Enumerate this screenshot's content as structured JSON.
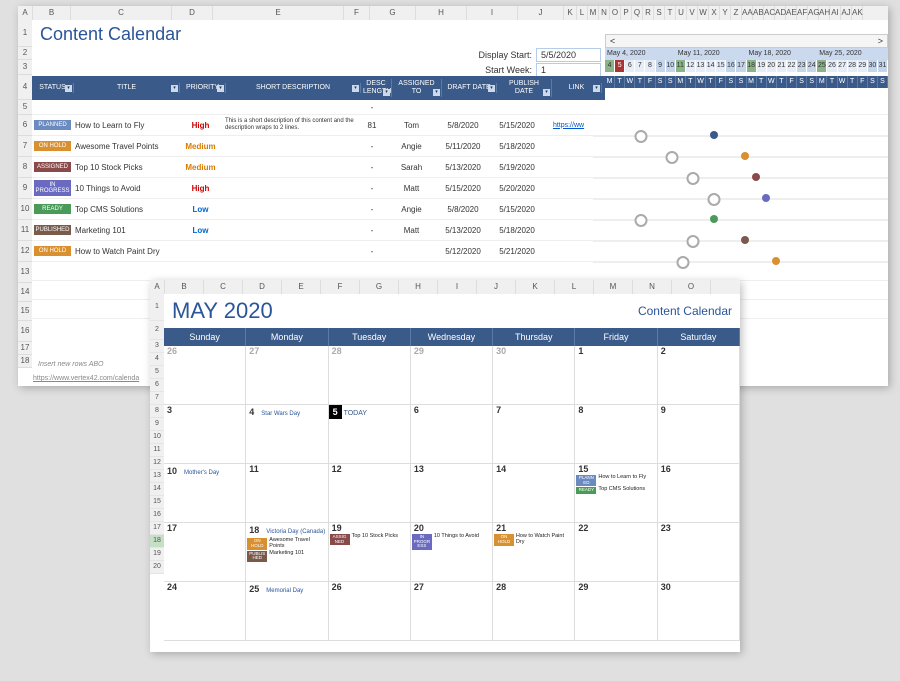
{
  "sheet1": {
    "title": "Content Calendar",
    "col_headers": [
      "A",
      "B",
      "C",
      "D",
      "E",
      "F",
      "G",
      "H",
      "I",
      "J",
      "K",
      "L",
      "M",
      "N",
      "O",
      "P",
      "Q",
      "R",
      "S",
      "T",
      "U",
      "V",
      "W",
      "X",
      "Y",
      "Z",
      "AA",
      "AB",
      "AC",
      "AD",
      "AE",
      "AF",
      "AG",
      "AH",
      "AI",
      "AJ",
      "AK"
    ],
    "row_numbers": [
      "1",
      "2",
      "3",
      "4",
      "5",
      "6",
      "7",
      "8",
      "9",
      "10",
      "11",
      "12",
      "13",
      "14",
      "15",
      "16",
      "17",
      "18"
    ],
    "display_start_label": "Display Start:",
    "display_start_value": "5/5/2020",
    "start_week_label": "Start Week:",
    "start_week_value": "1",
    "week_headers": [
      "May 4, 2020",
      "May 11, 2020",
      "May 18, 2020",
      "May 25, 2020"
    ],
    "day_letters": [
      "M",
      "T",
      "W",
      "T",
      "F",
      "S",
      "S",
      "M",
      "T",
      "W",
      "T",
      "F",
      "S",
      "S",
      "M",
      "T",
      "W",
      "T",
      "F",
      "S",
      "S",
      "M",
      "T",
      "W",
      "T",
      "F",
      "S",
      "S"
    ],
    "day_numbers": [
      "4",
      "5",
      "6",
      "7",
      "8",
      "9",
      "10",
      "11",
      "12",
      "13",
      "14",
      "15",
      "16",
      "17",
      "18",
      "19",
      "20",
      "21",
      "22",
      "23",
      "24",
      "25",
      "26",
      "27",
      "28",
      "29",
      "30",
      "31"
    ],
    "today_index": 1,
    "table_headers": [
      "STATUS",
      "TITLE",
      "PRIORITY",
      "SHORT DESCRIPTION",
      "DESC LENGTH",
      "ASSIGNED TO",
      "DRAFT DATE",
      "PUBLISH DATE",
      "LINK"
    ],
    "rows": [
      {
        "status": "PLANNED",
        "status_cls": "PLANNED",
        "title": "How to Learn to Fly",
        "priority": "High",
        "desc": "This is a short description of this content and the description wraps to 2 lines.",
        "desc_len": "81",
        "assigned": "Tom",
        "draft": "5/8/2020",
        "publish": "5/15/2020",
        "link": "https://ww",
        "draft_idx": 4,
        "pub_idx": 11,
        "pub_color": "#3a5a8a"
      },
      {
        "status": "ON HOLD",
        "status_cls": "ONHOLD",
        "title": "Awesome Travel Points",
        "priority": "Medium",
        "desc": "",
        "desc_len": "-",
        "assigned": "Angie",
        "draft": "5/11/2020",
        "publish": "5/18/2020",
        "link": "",
        "draft_idx": 7,
        "pub_idx": 14,
        "pub_color": "#d89030"
      },
      {
        "status": "ASSIGNED",
        "status_cls": "ASSIGNED",
        "title": "Top 10 Stock Picks",
        "priority": "Medium",
        "desc": "",
        "desc_len": "-",
        "assigned": "Sarah",
        "draft": "5/13/2020",
        "publish": "5/19/2020",
        "link": "",
        "draft_idx": 9,
        "pub_idx": 15,
        "pub_color": "#8a4a4a"
      },
      {
        "status": "IN PROGRESS",
        "status_cls": "INPROGRESS",
        "title": "10 Things to Avoid",
        "priority": "High",
        "desc": "",
        "desc_len": "-",
        "assigned": "Matt",
        "draft": "5/15/2020",
        "publish": "5/20/2020",
        "link": "",
        "draft_idx": 11,
        "pub_idx": 16,
        "pub_color": "#6a6ac0"
      },
      {
        "status": "READY",
        "status_cls": "READY",
        "title": "Top CMS Solutions",
        "priority": "Low",
        "desc": "",
        "desc_len": "-",
        "assigned": "Angie",
        "draft": "5/8/2020",
        "publish": "5/15/2020",
        "link": "",
        "draft_idx": 4,
        "pub_idx": 11,
        "pub_color": "#4a9a5a"
      },
      {
        "status": "PUBLISHED",
        "status_cls": "PUBLISHED",
        "title": "Marketing 101",
        "priority": "Low",
        "desc": "",
        "desc_len": "-",
        "assigned": "Matt",
        "draft": "5/13/2020",
        "publish": "5/18/2020",
        "link": "",
        "draft_idx": 9,
        "pub_idx": 14,
        "pub_color": "#7a5a4a"
      },
      {
        "status": "ON HOLD",
        "status_cls": "ONHOLD",
        "title": "How to Watch Paint Dry",
        "priority": "",
        "desc": "",
        "desc_len": "-",
        "assigned": "",
        "draft": "5/12/2020",
        "publish": "5/21/2020",
        "link": "",
        "draft_idx": 8,
        "pub_idx": 17,
        "pub_color": "#d89030"
      }
    ],
    "footer_note": "Insert new rows ABO",
    "footer_link": "https://www.vertex42.com/calenda"
  },
  "sheet2": {
    "col_headers": [
      "A",
      "B",
      "C",
      "D",
      "E",
      "F",
      "G",
      "H",
      "I",
      "J",
      "K",
      "L",
      "M",
      "N",
      "O"
    ],
    "row_numbers": [
      "1",
      "2",
      "3",
      "4",
      "5",
      "6",
      "7",
      "8",
      "9",
      "10",
      "11",
      "12",
      "13",
      "14",
      "15",
      "16",
      "17",
      "18",
      "19",
      "20"
    ],
    "month": "MAY 2020",
    "name": "Content Calendar",
    "day_headers": [
      "Sunday",
      "Monday",
      "Tuesday",
      "Wednesday",
      "Thursday",
      "Friday",
      "Saturday"
    ],
    "weeks": [
      [
        {
          "n": "26",
          "faded": true
        },
        {
          "n": "27",
          "faded": true
        },
        {
          "n": "28",
          "faded": true
        },
        {
          "n": "29",
          "faded": true
        },
        {
          "n": "30",
          "faded": true
        },
        {
          "n": "1"
        },
        {
          "n": "2"
        }
      ],
      [
        {
          "n": "3"
        },
        {
          "n": "4",
          "event": "Star Wars Day"
        },
        {
          "n": "5",
          "today": true,
          "today_label": "TODAY"
        },
        {
          "n": "6"
        },
        {
          "n": "7"
        },
        {
          "n": "8"
        },
        {
          "n": "9"
        }
      ],
      [
        {
          "n": "10",
          "event": "Mother's Day"
        },
        {
          "n": "11"
        },
        {
          "n": "12"
        },
        {
          "n": "13"
        },
        {
          "n": "14"
        },
        {
          "n": "15",
          "items": [
            {
              "badge": "PLANN ED",
              "bcls": "PLANNED",
              "txt": "How to Learn to Fly"
            },
            {
              "badge": "READY",
              "bcls": "READY",
              "txt": "Top CMS Solutions"
            }
          ]
        },
        {
          "n": "16"
        }
      ],
      [
        {
          "n": "17"
        },
        {
          "n": "18",
          "event": "Victoria Day (Canada)",
          "items": [
            {
              "badge": "ON HOLD",
              "bcls": "ONHOLD",
              "txt": "Awesome Travel Points"
            },
            {
              "badge": "PUBLIS HED",
              "bcls": "PUBLISHED",
              "txt": "Marketing 101"
            }
          ]
        },
        {
          "n": "19",
          "items": [
            {
              "badge": "ASSIG NED",
              "bcls": "ASSIGNED",
              "txt": "Top 10 Stock Picks"
            }
          ]
        },
        {
          "n": "20",
          "items": [
            {
              "badge": "IN PROGR ESS",
              "bcls": "INPROGRESS",
              "txt": "10 Things to Avoid"
            }
          ]
        },
        {
          "n": "21",
          "items": [
            {
              "badge": "ON HOLD",
              "bcls": "ONHOLD",
              "txt": "How to Watch Paint Dry"
            }
          ]
        },
        {
          "n": "22"
        },
        {
          "n": "23"
        }
      ],
      [
        {
          "n": "24"
        },
        {
          "n": "25",
          "event": "Memorial Day"
        },
        {
          "n": "26"
        },
        {
          "n": "27"
        },
        {
          "n": "28"
        },
        {
          "n": "29"
        },
        {
          "n": "30"
        }
      ]
    ]
  }
}
